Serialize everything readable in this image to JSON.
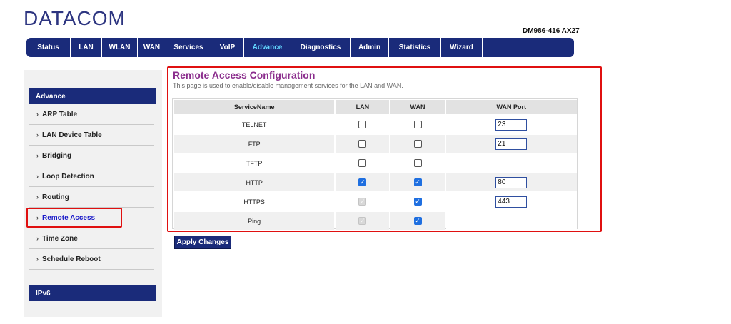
{
  "brand": {
    "logo": "DATACOM",
    "model": "DM986-416 AX27"
  },
  "nav": {
    "tabs": [
      {
        "label": "Status",
        "active": false
      },
      {
        "label": "LAN",
        "active": false
      },
      {
        "label": "WLAN",
        "active": false
      },
      {
        "label": "WAN",
        "active": false
      },
      {
        "label": "Services",
        "active": false
      },
      {
        "label": "VoIP",
        "active": false
      },
      {
        "label": "Advance",
        "active": true
      },
      {
        "label": "Diagnostics",
        "active": false
      },
      {
        "label": "Admin",
        "active": false
      },
      {
        "label": "Statistics",
        "active": false
      },
      {
        "label": "Wizard",
        "active": false
      }
    ]
  },
  "sidebar": {
    "section_advance": "Advance",
    "section_ipv6": "IPv6",
    "arrow": "›",
    "items": [
      {
        "label": "ARP Table",
        "active": false
      },
      {
        "label": "LAN Device Table",
        "active": false
      },
      {
        "label": "Bridging",
        "active": false
      },
      {
        "label": "Loop Detection",
        "active": false
      },
      {
        "label": "Routing",
        "active": false
      },
      {
        "label": "Remote Access",
        "active": true
      },
      {
        "label": "Time Zone",
        "active": false
      },
      {
        "label": "Schedule Reboot",
        "active": false
      }
    ]
  },
  "main": {
    "title": "Remote Access Configuration",
    "description": "This page is used to enable/disable management services for the LAN and WAN.",
    "columns": [
      "ServiceName",
      "LAN",
      "WAN",
      "WAN Port"
    ],
    "rows": [
      {
        "service": "TELNET",
        "lan": "unchecked",
        "wan": "unchecked",
        "port": "23"
      },
      {
        "service": "FTP",
        "lan": "unchecked",
        "wan": "unchecked",
        "port": "21"
      },
      {
        "service": "TFTP",
        "lan": "unchecked",
        "wan": "unchecked",
        "port": null
      },
      {
        "service": "HTTP",
        "lan": "checked",
        "wan": "checked",
        "port": "80"
      },
      {
        "service": "HTTPS",
        "lan": "disabled-checked",
        "wan": "checked",
        "port": "443"
      },
      {
        "service": "Ping",
        "lan": "disabled-checked",
        "wan": "checked",
        "port": null
      }
    ],
    "apply_label": "Apply Changes"
  },
  "colors": {
    "nav_bg": "#1a2b7a",
    "active_tab": "#63d7ff",
    "title": "#8a2c8c",
    "highlight": "#e01010",
    "checkbox_on": "#1f6fe0"
  }
}
